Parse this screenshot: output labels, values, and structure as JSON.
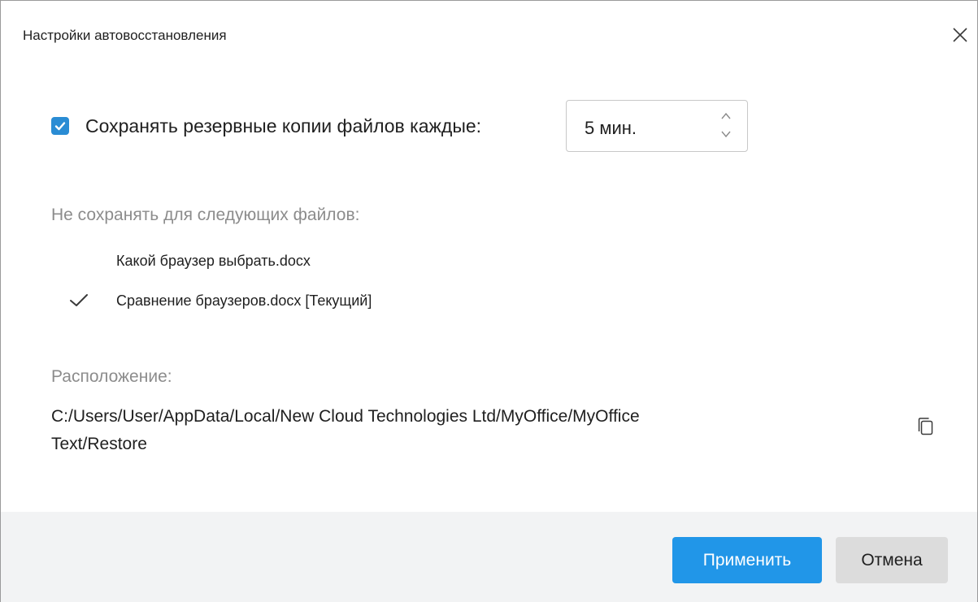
{
  "dialog": {
    "title": "Настройки автовосстановления",
    "close_icon": "close-icon"
  },
  "autosave": {
    "checked": true,
    "label": "Сохранять резервные копии файлов каждые:",
    "interval_value": "5 мин."
  },
  "exclusions": {
    "header": "Не сохранять для следующих файлов:",
    "files": [
      {
        "label": "Какой браузер выбрать.docx",
        "checked": false
      },
      {
        "label": "Сравнение браузеров.docx [Текущий]",
        "checked": true
      }
    ]
  },
  "location": {
    "header": "Расположение:",
    "path_line1": "C:/Users/User/AppData/Local/New Cloud Technologies Ltd/MyOffice/MyOffice",
    "path_line2": "Text/Restore",
    "copy_icon": "copy-icon"
  },
  "footer": {
    "apply_label": "Применить",
    "cancel_label": "Отмена"
  },
  "colors": {
    "accent": "#2196e8",
    "checkbox": "#2a8cd4",
    "footer_bg": "#f2f3f4",
    "muted_text": "#8c8c8c"
  }
}
